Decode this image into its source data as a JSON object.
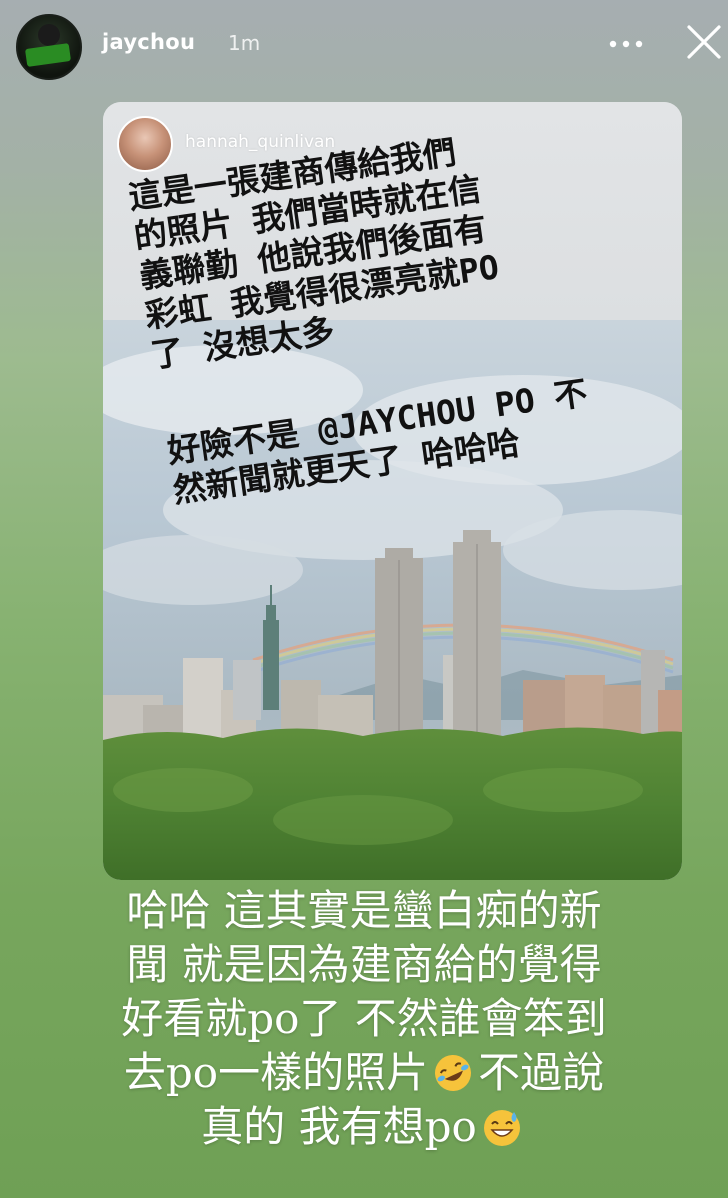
{
  "header": {
    "username": "jaychou",
    "timestamp": "1m",
    "icons": {
      "more": "more-horizontal-icon",
      "close": "close-icon"
    }
  },
  "shared_post": {
    "username": "hannah_quinlivan",
    "handwritten_note_lines": [
      "這是一張建商傳給我們",
      "的照片 我們當時就在信",
      "義聯勤 他說我們後面有",
      "彩虹 我覺得很漂亮就PO",
      "了 沒想太多"
    ],
    "handwritten_note_2_lines": [
      "好險不是 @JAYCHOU PO 不",
      "然新聞就更天了 哈哈哈"
    ]
  },
  "caption": {
    "lines": [
      "哈哈 這其實是蠻白痴的新",
      "聞 就是因為建商給的覺得",
      "好看就po了 不然誰會笨到",
      "去po一樣的照片",
      "不過說",
      "真的 我有想po"
    ],
    "emojis": [
      "rolling-on-floor-laughing-emoji",
      "grinning-sweat-emoji"
    ]
  },
  "colors": {
    "background_top": "#a6aeb1",
    "background_bottom": "#6fa055",
    "text": "#ffffff"
  }
}
